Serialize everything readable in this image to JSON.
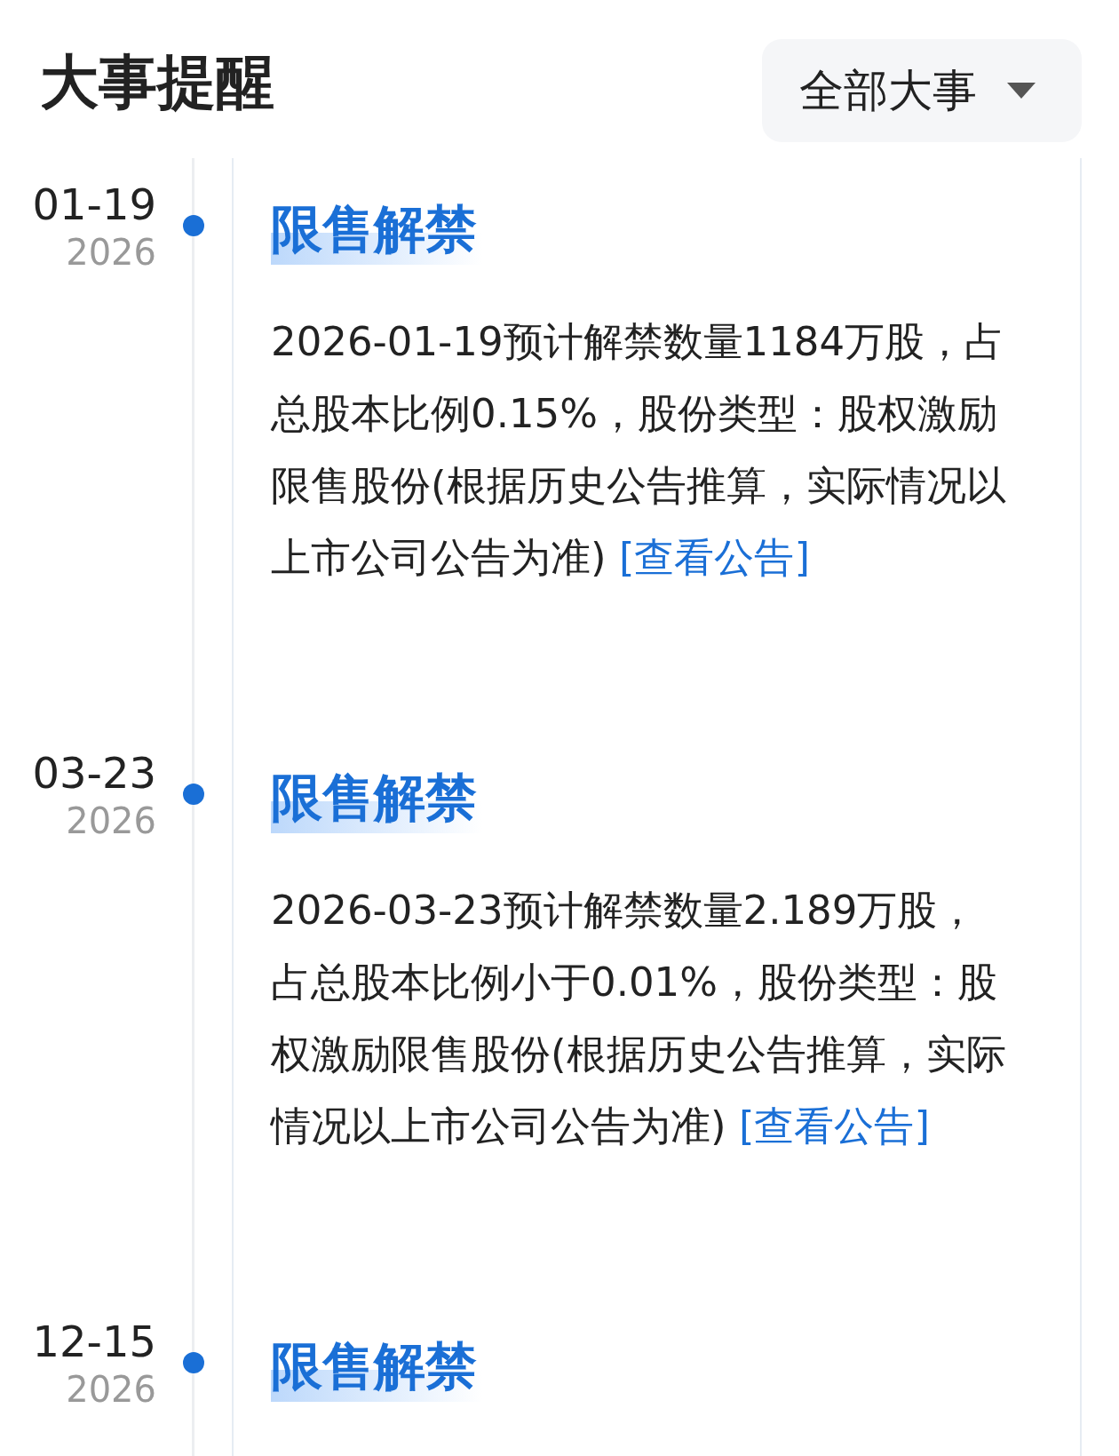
{
  "header": {
    "title": "大事提醒",
    "filter": {
      "label": "全部大事"
    }
  },
  "events": [
    {
      "date": "01-19",
      "year": "2026",
      "tag": "限售解禁",
      "text": "2026-01-19预计解禁数量1184万股，占总股本比例0.15%，股份类型：股权激励限售股份(根据历史公告推算，实际情况以上市公司公告为准)",
      "link": "[查看公告]"
    },
    {
      "date": "03-23",
      "year": "2026",
      "tag": "限售解禁",
      "text": "2026-03-23预计解禁数量2.189万股，占总股本比例小于0.01%，股份类型：股权激励限售股份(根据历史公告推算，实际情况以上市公司公告为准)",
      "link": "[查看公告]"
    },
    {
      "date": "12-15",
      "year": "2026",
      "tag": "限售解禁"
    }
  ]
}
